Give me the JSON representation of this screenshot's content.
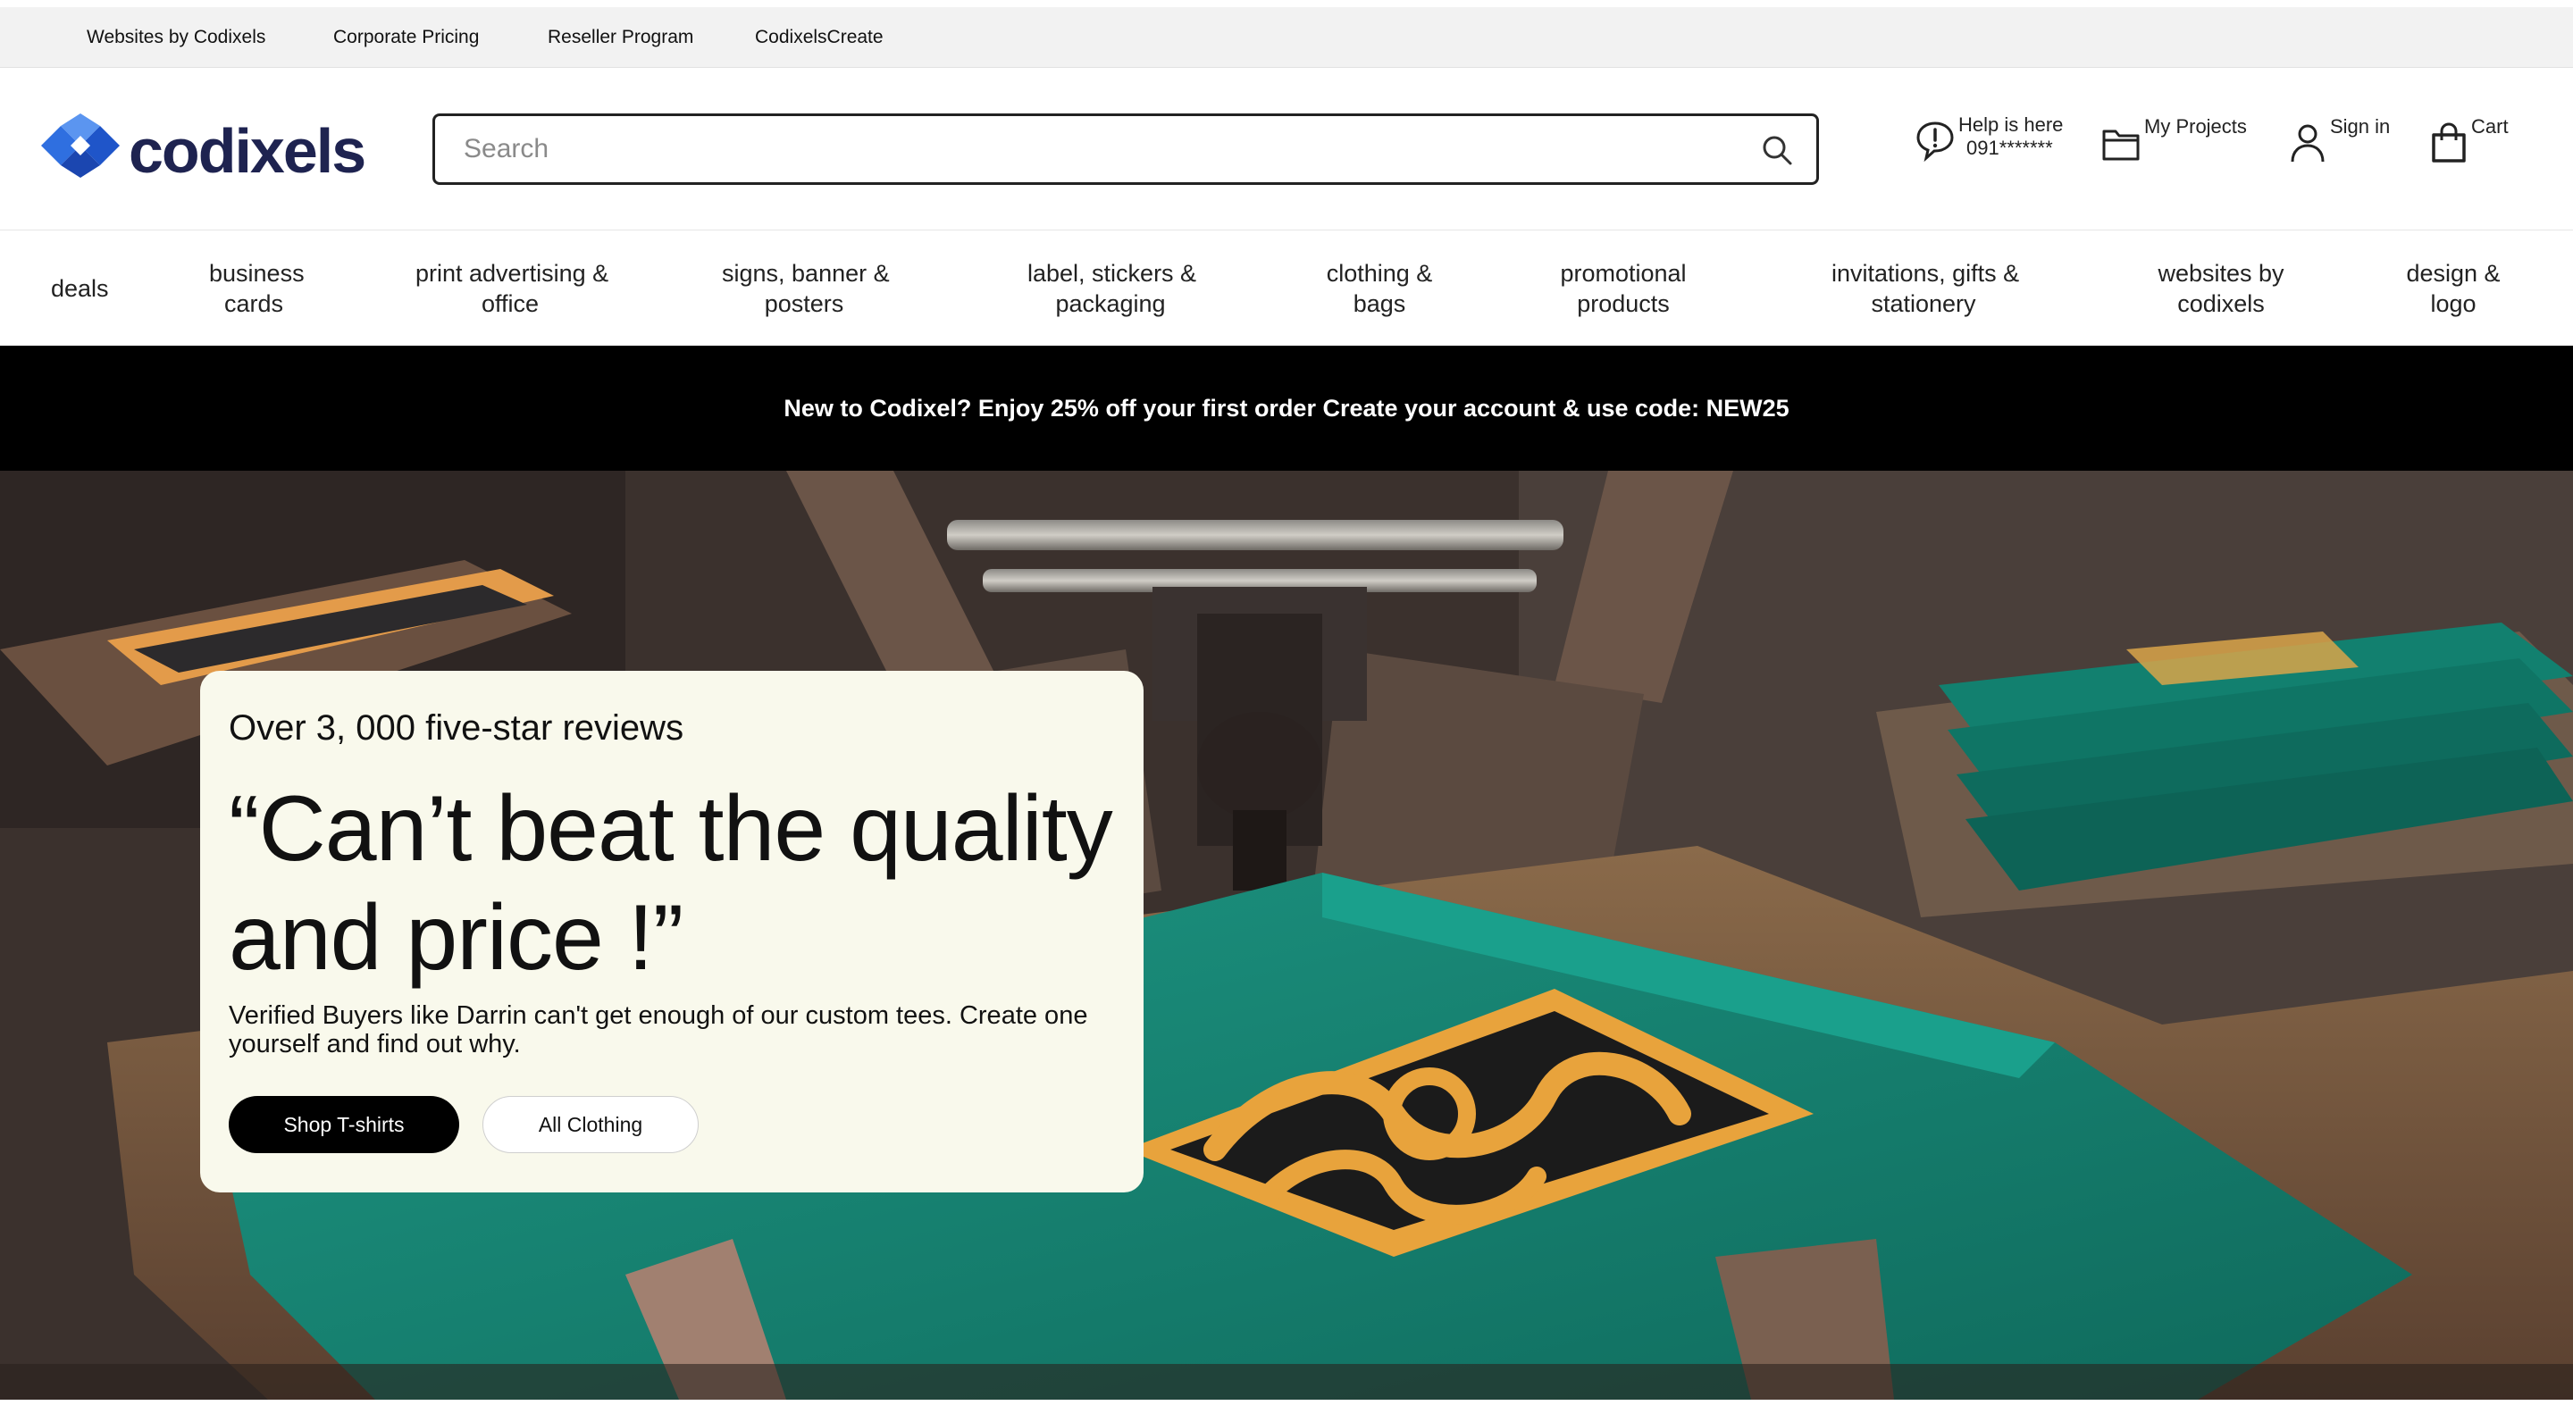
{
  "utility_nav": {
    "links": [
      "Websites by Codixels",
      "Corporate Pricing",
      "Reseller Program",
      "CodixelsCreate"
    ]
  },
  "header": {
    "logo_text": "codixels",
    "search": {
      "placeholder": "Search",
      "value": ""
    },
    "help": {
      "title": "Help is here",
      "phone": "091*******"
    },
    "my_projects": "My Projects",
    "sign_in": "Sign in",
    "cart": "Cart"
  },
  "categories": [
    {
      "line1": "deals",
      "line2": ""
    },
    {
      "line1": "business",
      "line2": "cards"
    },
    {
      "line1": "print advertising &",
      "line2": "office"
    },
    {
      "line1": "signs, banner &",
      "line2": "posters"
    },
    {
      "line1": "label, stickers &",
      "line2": "packaging"
    },
    {
      "line1": "clothing &",
      "line2": "bags"
    },
    {
      "line1": "promotional",
      "line2": "products"
    },
    {
      "line1": "invitations, gifts &",
      "line2": "stationery"
    },
    {
      "line1": "websites by",
      "line2": "codixels"
    },
    {
      "line1": "design &",
      "line2": "logo"
    }
  ],
  "promo": {
    "text": "New to Codixel? Enjoy 25% off your first order Create your account & use code: NEW25"
  },
  "hero": {
    "eyebrow": "Over 3, 000 five-star reviews",
    "quote": "“Can’t beat the quality and price !”",
    "body": "Verified Buyers like Darrin can't get enough of our custom tees. Create one yourself and find out why.",
    "primary_button": "Shop T-shirts",
    "secondary_button": "All Clothing"
  },
  "colors": {
    "logo_navy": "#1e2350",
    "logo_blue": "#2f6fe0",
    "hero_card": "#f9f9ec",
    "shirt_teal": "#15806f",
    "print_orange": "#e8a33c"
  }
}
